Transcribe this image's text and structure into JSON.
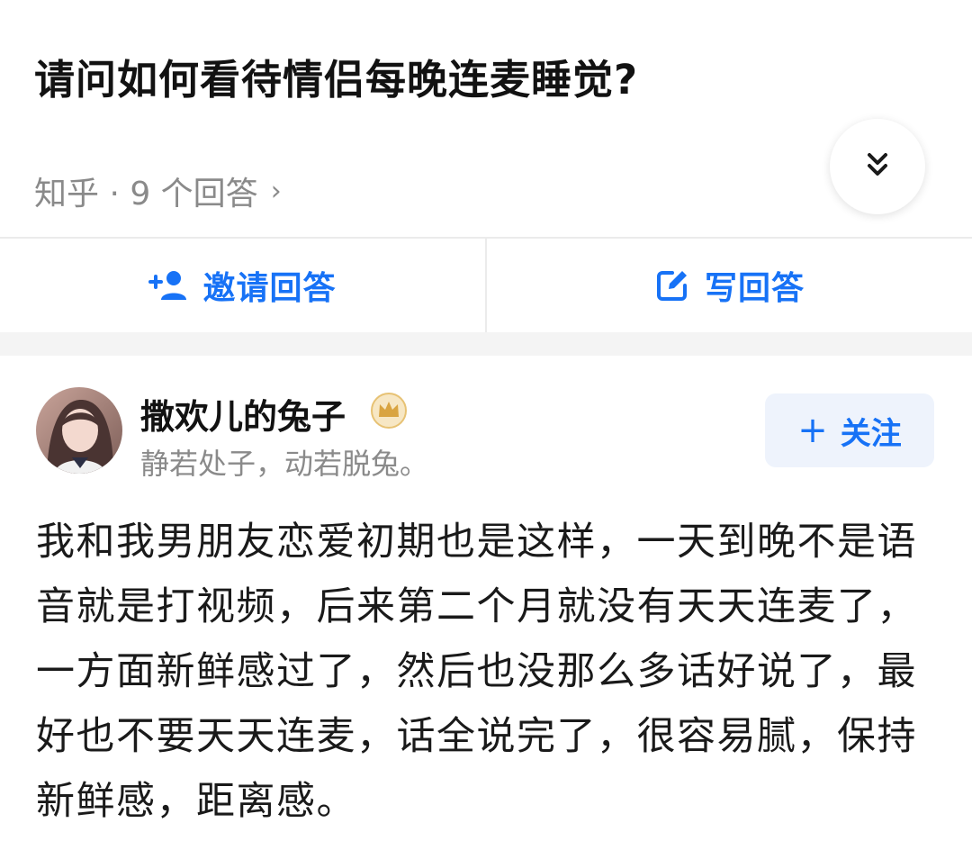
{
  "question": {
    "title": "请问如何看待情侣每晚连麦睡觉?",
    "meta": "知乎 · 9 个回答",
    "meta_chevron": "›"
  },
  "actions": {
    "invite_label": "邀请回答",
    "write_label": "写回答"
  },
  "answer": {
    "author_name": "撒欢儿的兔子",
    "author_bio": "静若处子，动若脱兔。",
    "follow_label": "关注",
    "follow_plus": "+",
    "lines": [
      "我和我男朋友恋爱初期也是这样，一天到晚不是语",
      "音就是打视频，后来第二个月就没有天天连麦了，",
      "一方面新鲜感过了，然后也没那么多话好说了，最",
      "好也不要天天连麦，话全说完了，很容易腻，保持",
      "新鲜感，距离感。"
    ]
  },
  "icons": {
    "expand": "chevron-double-down-icon",
    "invite": "add-user-icon",
    "write": "edit-icon",
    "badge": "crown-badge-icon"
  },
  "colors": {
    "accent": "#1772f6",
    "muted_text": "#8a8a8a",
    "badge_gold": "#d9a441"
  }
}
